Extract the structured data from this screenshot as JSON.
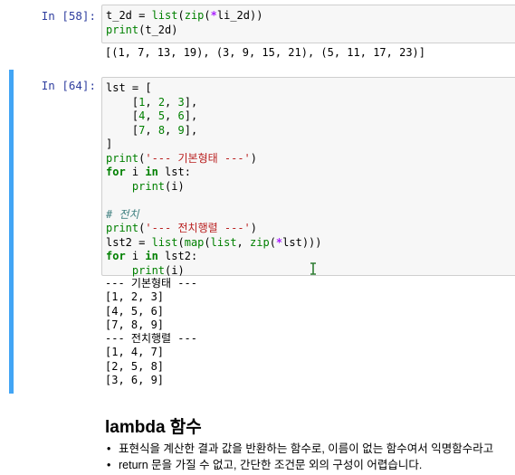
{
  "cell58": {
    "prompt": "In [58]:",
    "code": [
      [
        [
          "",
          "t_2d = "
        ],
        [
          "bi",
          "list"
        ],
        [
          "",
          "("
        ],
        [
          "bi",
          "zip"
        ],
        [
          "",
          "("
        ],
        [
          "op",
          "*"
        ],
        [
          "",
          "li_2d))"
        ]
      ],
      [
        [
          "bi",
          "print"
        ],
        [
          "",
          "(t_2d)"
        ]
      ]
    ],
    "output": "[(1, 7, 13, 19), (3, 9, 15, 21), (5, 11, 17, 23)]"
  },
  "cell64": {
    "prompt": "In [64]:",
    "code": [
      [
        [
          "",
          "lst = ["
        ]
      ],
      [
        [
          "",
          "    ["
        ],
        [
          "num",
          "1"
        ],
        [
          "",
          ", "
        ],
        [
          "num",
          "2"
        ],
        [
          "",
          ", "
        ],
        [
          "num",
          "3"
        ],
        [
          "",
          "],"
        ]
      ],
      [
        [
          "",
          "    ["
        ],
        [
          "num",
          "4"
        ],
        [
          "",
          ", "
        ],
        [
          "num",
          "5"
        ],
        [
          "",
          ", "
        ],
        [
          "num",
          "6"
        ],
        [
          "",
          "],"
        ]
      ],
      [
        [
          "",
          "    ["
        ],
        [
          "num",
          "7"
        ],
        [
          "",
          ", "
        ],
        [
          "num",
          "8"
        ],
        [
          "",
          ", "
        ],
        [
          "num",
          "9"
        ],
        [
          "",
          "],"
        ]
      ],
      [
        [
          "",
          "]"
        ]
      ],
      [
        [
          "bi",
          "print"
        ],
        [
          "",
          "("
        ],
        [
          "str",
          "'--- 기본형태 ---'"
        ],
        [
          "",
          ")"
        ]
      ],
      [
        [
          "kw",
          "for"
        ],
        [
          "",
          " i "
        ],
        [
          "kw",
          "in"
        ],
        [
          "",
          " lst:"
        ]
      ],
      [
        [
          "",
          "    "
        ],
        [
          "bi",
          "print"
        ],
        [
          "",
          "(i)"
        ]
      ],
      [
        [
          "",
          ""
        ]
      ],
      [
        [
          "cm",
          "# 전치"
        ]
      ],
      [
        [
          "bi",
          "print"
        ],
        [
          "",
          "("
        ],
        [
          "str",
          "'--- 전치행렬 ---'"
        ],
        [
          "",
          ")"
        ]
      ],
      [
        [
          "",
          "lst2 = "
        ],
        [
          "bi",
          "list"
        ],
        [
          "",
          "("
        ],
        [
          "bi",
          "map"
        ],
        [
          "",
          "("
        ],
        [
          "bi",
          "list"
        ],
        [
          "",
          ", "
        ],
        [
          "bi",
          "zip"
        ],
        [
          "",
          "("
        ],
        [
          "op",
          "*"
        ],
        [
          "",
          "lst)))"
        ]
      ],
      [
        [
          "kw",
          "for"
        ],
        [
          "",
          " i "
        ],
        [
          "kw",
          "in"
        ],
        [
          "",
          " lst2:"
        ]
      ],
      [
        [
          "",
          "    "
        ],
        [
          "bi",
          "print"
        ],
        [
          "",
          "(i)"
        ]
      ]
    ],
    "output": [
      "--- 기본형태 ---",
      "[1, 2, 3]",
      "[4, 5, 6]",
      "[7, 8, 9]",
      "--- 전치행렬 ---",
      "[1, 4, 7]",
      "[2, 5, 8]",
      "[3, 6, 9]"
    ]
  },
  "markdown": {
    "heading": "lambda 함수",
    "bullets": [
      "표현식을 계산한 결과 값을 반환하는 함수로, 이름이 없는 함수여서 익명함수라고",
      "return 문을 가질 수 없고, 간단한 조건문 외의 구성이 어렵습니다."
    ]
  },
  "colors": {
    "prompt": "#303f9f",
    "selected_bar": "#42a5f5",
    "keyword": "#008000",
    "string": "#ba2121",
    "comment": "#408080",
    "operator": "#aa22ff"
  },
  "icons": {
    "cursor": "text-cursor-icon"
  }
}
